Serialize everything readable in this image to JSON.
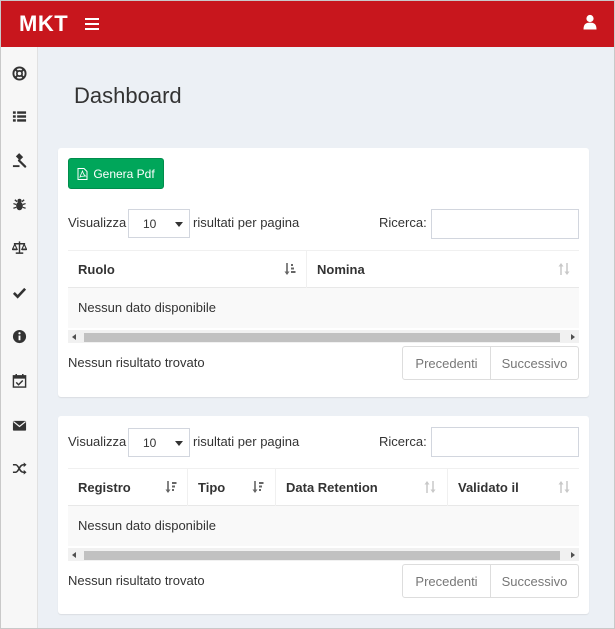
{
  "header": {
    "brand": "MKT"
  },
  "sidebar": {
    "items": [
      {
        "icon": "life-ring-icon"
      },
      {
        "icon": "list-icon"
      },
      {
        "icon": "gavel-icon"
      },
      {
        "icon": "bug-icon"
      },
      {
        "icon": "balance-scale-icon"
      },
      {
        "icon": "check-icon"
      },
      {
        "icon": "info-circle-icon"
      },
      {
        "icon": "calendar-check-icon"
      },
      {
        "icon": "envelope-icon"
      },
      {
        "icon": "random-icon"
      }
    ]
  },
  "page": {
    "title": "Dashboard"
  },
  "table1": {
    "pdf_label": "Genera Pdf",
    "show_label": "Visualizza",
    "page_length": "10",
    "per_page_label": "risultati per pagina",
    "search_label": "Ricerca:",
    "columns": [
      "Ruolo",
      "Nomina"
    ],
    "empty_text": "Nessun dato disponibile",
    "info": "Nessun risultato trovato",
    "prev_label": "Precedenti",
    "next_label": "Successivo"
  },
  "table2": {
    "show_label": "Visualizza",
    "page_length": "10",
    "per_page_label": "risultati per pagina",
    "search_label": "Ricerca:",
    "columns": [
      "Registro",
      "Tipo",
      "Data Retention",
      "Validato il"
    ],
    "empty_text": "Nessun dato disponibile",
    "info": "Nessun risultato trovato",
    "prev_label": "Precedenti",
    "next_label": "Successivo"
  },
  "colors": {
    "header": "#c8161d",
    "accent_button": "#00a65a",
    "background": "#ecf0f5"
  }
}
